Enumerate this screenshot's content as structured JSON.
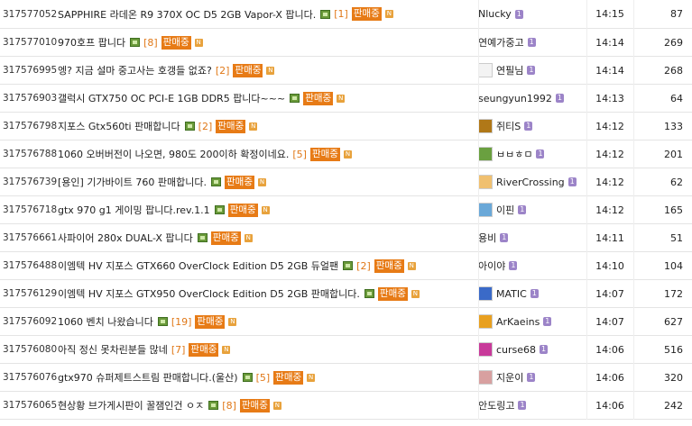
{
  "rows": [
    {
      "no": "317577052",
      "title": "SAPPHIRE 라데온 R9 370X OC D5 2GB Vapor-X 팝니다.",
      "img": true,
      "comments": "[1]",
      "sale": "판매중",
      "author": "Nlucky",
      "avatar": "",
      "time": "14:15",
      "hits": "87"
    },
    {
      "no": "317577010",
      "title": "970호프 팝니다",
      "img": true,
      "comments": "[8]",
      "sale": "판매중",
      "author": "연예가중고",
      "avatar": "",
      "time": "14:14",
      "hits": "269"
    },
    {
      "no": "317576995",
      "title": "엥? 지금 설마 중고사는 호갱들 없죠?",
      "img": false,
      "comments": "[2]",
      "sale": "판매중",
      "author": "연필님",
      "avatar": "#f3f3f3",
      "time": "14:14",
      "hits": "268"
    },
    {
      "no": "317576903",
      "title": "갤럭시 GTX750 OC PCI-E 1GB DDR5 팝니다~~~",
      "img": true,
      "comments": "",
      "sale": "판매중",
      "author": "seungyun1992",
      "avatar": "",
      "time": "14:13",
      "hits": "64"
    },
    {
      "no": "317576798",
      "title": "지포스 Gtx560ti 판매합니다",
      "img": true,
      "comments": "[2]",
      "sale": "판매중",
      "author": "쥐티S",
      "avatar": "#b07818",
      "time": "14:12",
      "hits": "133"
    },
    {
      "no": "317576788",
      "title": "1060 오버버전이 나오면, 980도 200이하 확정이네요.",
      "img": false,
      "comments": "[5]",
      "sale": "판매중",
      "author": "ㅂㅂㅎㅁ",
      "avatar": "#6aa040",
      "time": "14:12",
      "hits": "201"
    },
    {
      "no": "317576739",
      "title": "[용인] 기가바이트 760 판매합니다.",
      "img": true,
      "comments": "",
      "sale": "판매중",
      "author": "RiverCrossing",
      "avatar": "#f0c070",
      "time": "14:12",
      "hits": "62"
    },
    {
      "no": "317576718",
      "title": "gtx 970 g1 게이밍 팝니다.rev.1.1",
      "img": true,
      "comments": "",
      "sale": "판매중",
      "author": "이핀",
      "avatar": "#6aa8d8",
      "time": "14:12",
      "hits": "165"
    },
    {
      "no": "317576661",
      "title": "사파이어 280x DUAL-X 팝니다",
      "img": true,
      "comments": "",
      "sale": "판매중",
      "author": "용비",
      "avatar": "",
      "time": "14:11",
      "hits": "51"
    },
    {
      "no": "317576488",
      "title": "이엠텍 HV 지포스 GTX660 OverClock Edition D5 2GB 듀얼팬",
      "img": true,
      "comments": "[2]",
      "sale": "판매중",
      "author": "아이야",
      "avatar": "",
      "time": "14:10",
      "hits": "104"
    },
    {
      "no": "317576129",
      "title": "이엠텍 HV 지포스 GTX950 OverClock Edition D5 2GB 판매합니다.",
      "img": true,
      "comments": "",
      "sale": "판매중",
      "author": "MATIC",
      "avatar": "#3a6ac8",
      "time": "14:07",
      "hits": "172"
    },
    {
      "no": "317576092",
      "title": "1060 벤치 나왔습니다",
      "img": true,
      "comments": "[19]",
      "sale": "판매중",
      "author": "ArKaeins",
      "avatar": "#e8a020",
      "time": "14:07",
      "hits": "627"
    },
    {
      "no": "317576080",
      "title": "아직 정신 못차린분들 많네",
      "img": false,
      "comments": "[7]",
      "sale": "판매중",
      "author": "curse68",
      "avatar": "#c83a9a",
      "time": "14:06",
      "hits": "516"
    },
    {
      "no": "317576076",
      "title": "gtx970 슈퍼제트스트림 판매합니다.(울산)",
      "img": true,
      "comments": "[5]",
      "sale": "판매중",
      "author": "지운이",
      "avatar": "#d8a0a0",
      "time": "14:06",
      "hits": "320"
    },
    {
      "no": "317576065",
      "title": "현상황 브가게시판이 꿀잼인건 ㅇㅈ",
      "img": true,
      "comments": "[8]",
      "sale": "판매중",
      "author": "안도링고",
      "avatar": "",
      "time": "14:06",
      "hits": "242"
    }
  ],
  "new_badge": "N",
  "level_badge": "1"
}
